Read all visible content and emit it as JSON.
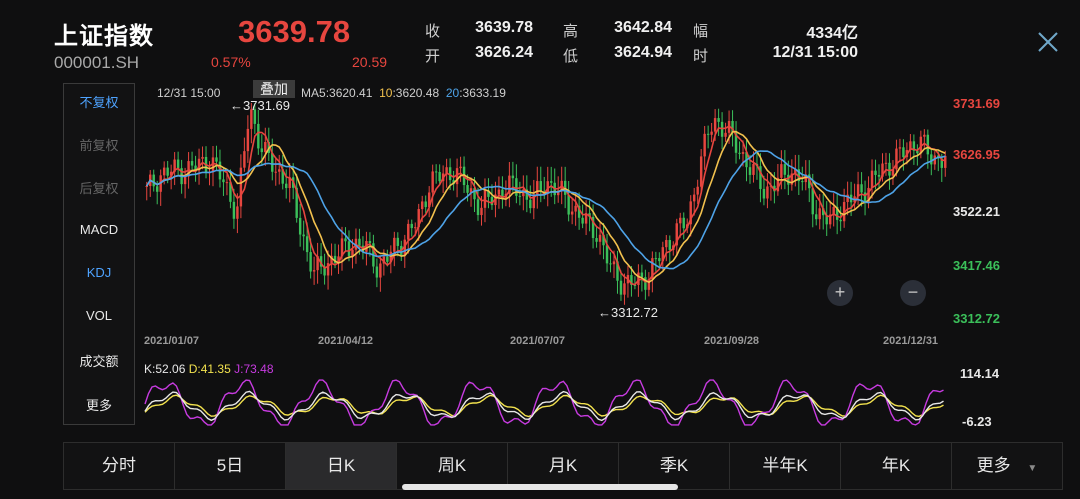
{
  "header": {
    "title": "上证指数",
    "code": "000001.SH",
    "price": "3639.78",
    "change_pct": "0.57%",
    "change_abs": "20.59",
    "stats": [
      {
        "label": "收",
        "value": "3639.78"
      },
      {
        "label": "高",
        "value": "3642.84"
      },
      {
        "label": "幅",
        "value": "4334亿"
      },
      {
        "label": "开",
        "value": "3626.24"
      },
      {
        "label": "低",
        "value": "3624.94"
      },
      {
        "label": "时",
        "value": "12/31 15:00"
      }
    ],
    "close_icon": "close-icon"
  },
  "left_panel": {
    "items": [
      {
        "label": "不复权",
        "color": "#4ea3ff"
      },
      {
        "label": "前复权",
        "color": "#666666"
      },
      {
        "label": "后复权",
        "color": "#666666"
      },
      {
        "label": "MACD",
        "color": "#e8e8e8"
      },
      {
        "label": "KDJ",
        "color": "#4ea3ff"
      },
      {
        "label": "VOL",
        "color": "#e8e8e8"
      },
      {
        "label": "成交额",
        "color": "#e8e8e8"
      },
      {
        "label": "更多",
        "color": "#e8e8e8"
      }
    ]
  },
  "chart_top": {
    "timestamp": "12/31 15:00",
    "overlay_label": "叠加",
    "ma": [
      {
        "key": "MA5",
        "value": ":3620.41",
        "color": "#e7463f"
      },
      {
        "key": "10",
        "value": ":3620.48",
        "color": "#f2c14e"
      },
      {
        "key": "20",
        "value": ":3633.19",
        "color": "#4ea3e8"
      }
    ],
    "high_marker": "←3731.69",
    "low_marker": "←3312.72",
    "zoom_in": "+",
    "zoom_out": "−"
  },
  "chart_data": [
    {
      "type": "candlestick",
      "title": "",
      "x_ticks": [
        "2021/01/07",
        "2021/04/12",
        "2021/07/07",
        "2021/09/28",
        "2021/12/31"
      ],
      "y_ticks": [
        "3731.69",
        "3626.95",
        "3522.21",
        "3417.46",
        "3312.72"
      ],
      "y_tick_colors": [
        "#e7463f",
        "#e7463f",
        "#e8e8e8",
        "#3bbf5a",
        "#3bbf5a"
      ],
      "ylim": [
        3312.72,
        3731.69
      ],
      "series": [
        {
          "name": "MA5",
          "color": "#e7463f"
        },
        {
          "name": "MA10",
          "color": "#f2c14e"
        },
        {
          "name": "MA20",
          "color": "#4ea3e8"
        }
      ],
      "close_values": [
        3560,
        3590,
        3600,
        3600,
        3610,
        3620,
        3575,
        3520,
        3720,
        3640,
        3600,
        3580,
        3480,
        3400,
        3420,
        3440,
        3460,
        3450,
        3410,
        3440,
        3470,
        3500,
        3580,
        3590,
        3600,
        3560,
        3530,
        3550,
        3570,
        3560,
        3540,
        3580,
        3560,
        3530,
        3500,
        3480,
        3410,
        3380,
        3380,
        3400,
        3440,
        3480,
        3500,
        3620,
        3700,
        3680,
        3640,
        3600,
        3560,
        3580,
        3600,
        3580,
        3520,
        3500,
        3530,
        3550,
        3570,
        3600,
        3620,
        3640,
        3660,
        3620,
        3630
      ],
      "high_label": "3731.69",
      "low_label": "3312.72"
    },
    {
      "type": "line",
      "title": "",
      "labels": [
        {
          "key": "K",
          "value": ":52.06",
          "color": "#e8e8e8"
        },
        {
          "key": "D",
          "value": ":41.35",
          "color": "#f2e24e"
        },
        {
          "key": "J",
          "value": ":73.48",
          "color": "#c73be0"
        }
      ],
      "y_ticks": [
        "114.14",
        "-6.23"
      ],
      "ylim": [
        -6.23,
        114.14
      ],
      "series": [
        {
          "name": "K",
          "color": "#e8e8e8"
        },
        {
          "name": "D",
          "color": "#f2e24e"
        },
        {
          "name": "J",
          "color": "#c73be0"
        }
      ]
    }
  ],
  "tabs": [
    {
      "label": "分时"
    },
    {
      "label": "5日"
    },
    {
      "label": "日K"
    },
    {
      "label": "周K"
    },
    {
      "label": "月K"
    },
    {
      "label": "季K"
    },
    {
      "label": "半年K"
    },
    {
      "label": "年K"
    },
    {
      "label": "更多"
    }
  ],
  "active_tab": "日K"
}
